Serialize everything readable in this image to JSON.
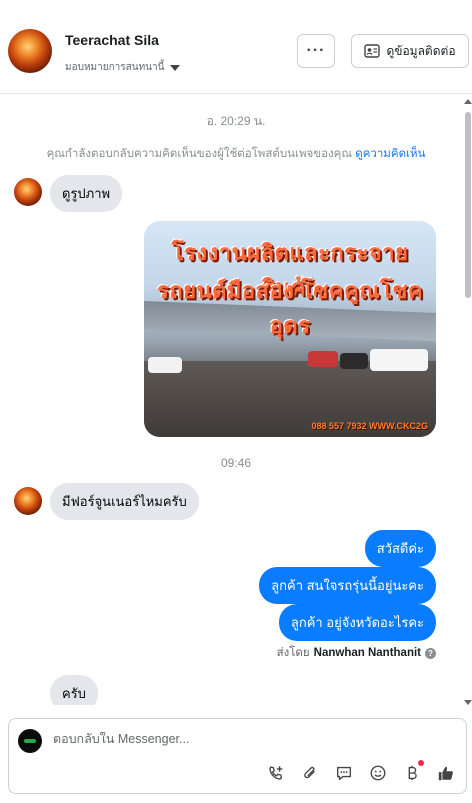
{
  "header": {
    "name": "Teerachat Sila",
    "assign_label": "มอบหมายการสนทนานี้",
    "more_label": "···",
    "contact_label": "ดูข้อมูลติดต่อ"
  },
  "thread": {
    "timestamp1": "อ. 20:29 น.",
    "notice_text": "คุณกำลังตอบกลับความคิดเห็นของผู้ใช้ต่อโพสต์บนเพจของคุณ",
    "notice_link": "ดูความคิดเห็น",
    "incoming1": "ดูรูปภาพ",
    "photo": {
      "title_line1": "โรงงานผลิตและกระจายสินค้า",
      "title_line2": "รถยนต์มือสอง โชคคูณโชคอุดร",
      "footer": "088 557 7932 WWW.CKC2G"
    },
    "timestamp2": "09:46",
    "incoming2": "มีฟอร์จูนเนอร์ไหมครับ",
    "outgoing": [
      "สวัสดีค่ะ",
      "ลูกค้า สนใจรถรุ่นนี้อยู่นะคะ",
      "ลูกค้า อยู่จังหวัดอะไรคะ"
    ],
    "sent_by_prefix": "ส่งโดย",
    "sent_by_name": "Nanwhan Nanthanit",
    "incoming3": "ครับ"
  },
  "composer": {
    "placeholder": "ตอบกลับใน Messenger..."
  },
  "icons": {
    "call": "phone-plus-icon",
    "attach": "paperclip-icon",
    "saved_replies": "chat-bubble-icon",
    "emoji": "emoji-icon",
    "payment": "baht-icon",
    "like": "thumbs-up-icon"
  },
  "colors": {
    "outgoing_bubble": "#0a7cff",
    "incoming_bubble": "#e4e6eb",
    "link": "#1877f2",
    "notification_dot": "#f02849"
  }
}
